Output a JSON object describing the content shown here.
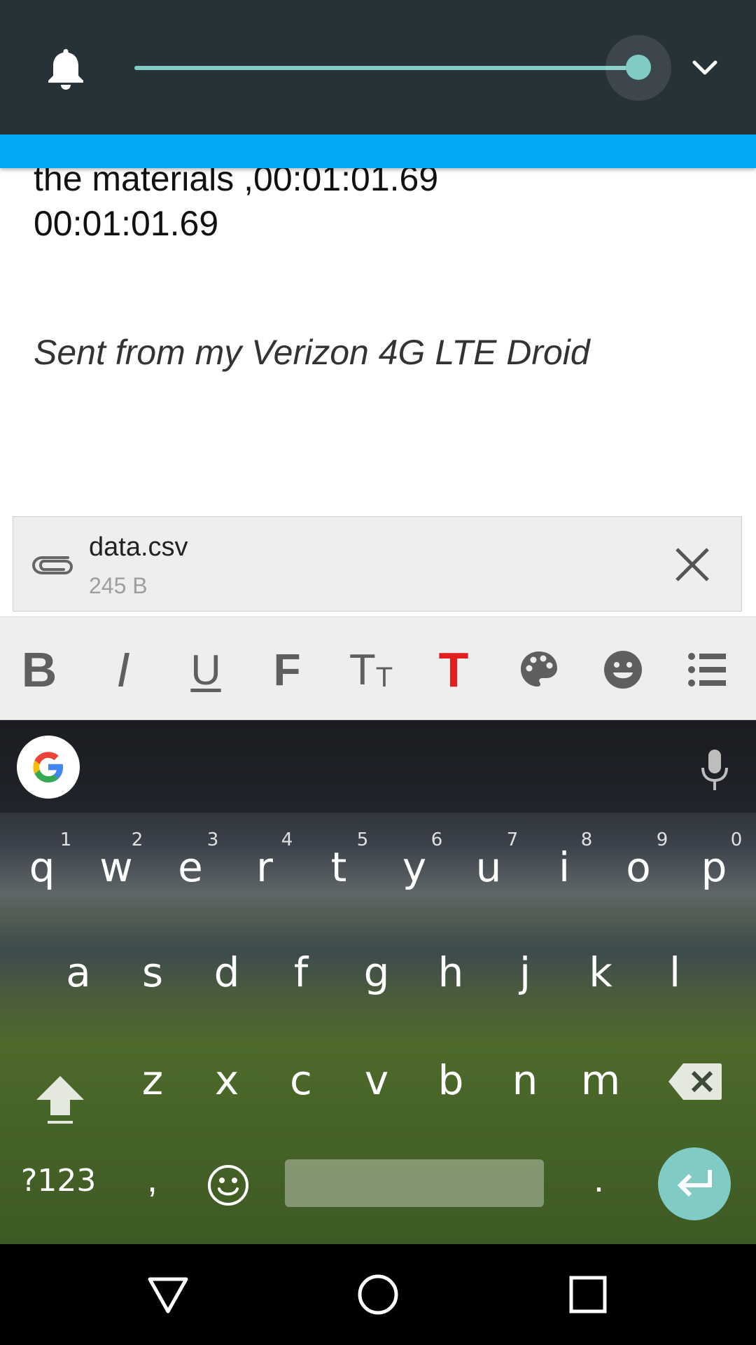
{
  "volume_panel": {
    "level": 1.0,
    "accent_color": "#80cbc4",
    "background_color": "#263238",
    "icons": [
      "bell-icon",
      "chevron-down-icon"
    ]
  },
  "toolbar_color": "#03a9f4",
  "compose": {
    "line1": "the materials ,00:01:01.69",
    "line2": "00:01:01.69",
    "signature": "Sent from my Verizon 4G LTE Droid"
  },
  "attachment": {
    "name": "data.csv",
    "size": "245 B",
    "icons": [
      "paperclip-icon",
      "close-icon"
    ]
  },
  "format_bar": {
    "bold": "B",
    "italic": "I",
    "underline": "U",
    "font": "F",
    "text_size": "T",
    "text_size_small": "T",
    "text_color": "T",
    "text_color_value": "#e11d1d",
    "icons": [
      "palette-icon",
      "smiley-icon",
      "bullet-list-icon"
    ]
  },
  "keyboard": {
    "row1": [
      "q",
      "w",
      "e",
      "r",
      "t",
      "y",
      "u",
      "i",
      "o",
      "p"
    ],
    "row1_hints": [
      "1",
      "2",
      "3",
      "4",
      "5",
      "6",
      "7",
      "8",
      "9",
      "0"
    ],
    "row2": [
      "a",
      "s",
      "d",
      "f",
      "g",
      "h",
      "j",
      "k",
      "l"
    ],
    "row3": [
      "z",
      "x",
      "c",
      "v",
      "b",
      "n",
      "m"
    ],
    "symbols_label": "?123",
    "comma": ",",
    "period": ".",
    "enter_color": "#80cbc4",
    "icons": [
      "google-icon",
      "microphone-icon",
      "shift-icon",
      "backspace-icon",
      "emoji-icon",
      "enter-icon"
    ]
  },
  "nav_bar": {
    "icons": [
      "back-icon",
      "home-icon",
      "recents-icon"
    ]
  }
}
